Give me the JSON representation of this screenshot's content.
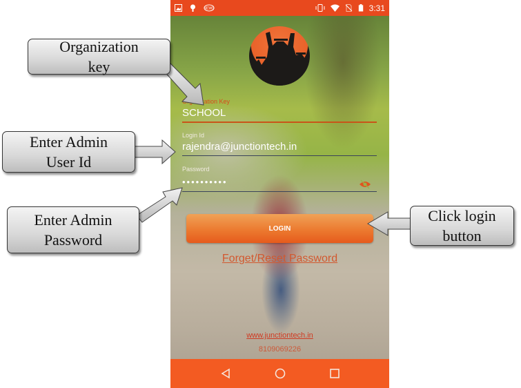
{
  "statusbar": {
    "left_icons": [
      "image-icon",
      "android-icon",
      "news-icon"
    ],
    "right_icons": [
      "vibrate-icon",
      "wifi-icon",
      "no-sim-icon",
      "battery-icon"
    ],
    "time": "3:31"
  },
  "colors": {
    "accent": "#e8491e",
    "navbar": "#f35b22",
    "button": "#ec7a30",
    "link": "#d2582f"
  },
  "logo": {
    "icon": "graduates-logo-icon"
  },
  "form": {
    "org_key": {
      "label": "Organization Key",
      "value": "SCHOOL"
    },
    "login_id": {
      "label": "Login Id",
      "value": "rajendra@junctiontech.in"
    },
    "password": {
      "label": "Password",
      "value": "••••••••••",
      "toggle_icon": "eye-off-icon"
    },
    "login_label": "LOGIN",
    "forget_label": "Forget/Reset Password"
  },
  "footer": {
    "website": "www.junctiontech.in",
    "phone": "8109069226"
  },
  "navbar": {
    "icons": [
      "back-icon",
      "home-icon",
      "recents-icon"
    ]
  },
  "callouts": {
    "org_key": "Organization\nkey",
    "user_id": "Enter Admin\nUser Id",
    "password": "Enter Admin\nPassword",
    "login": "Click login\nbutton"
  }
}
